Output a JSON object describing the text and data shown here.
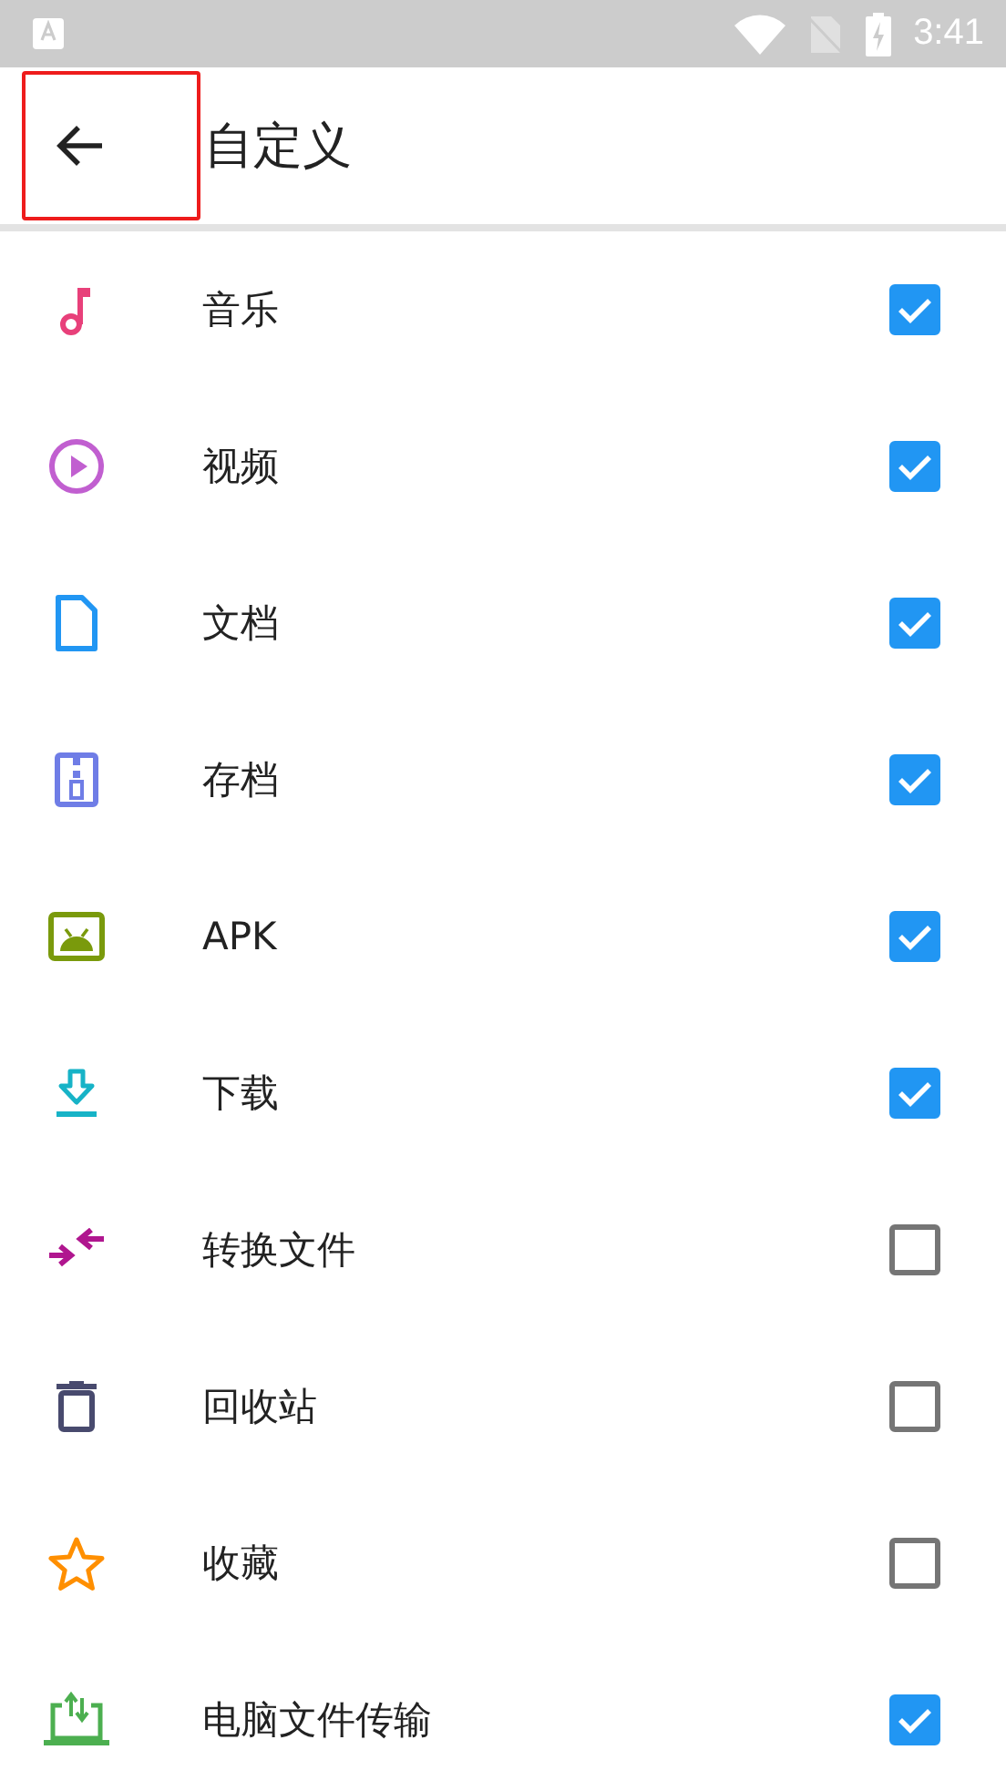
{
  "status_bar": {
    "time": "3:41"
  },
  "toolbar": {
    "title": "自定义",
    "back_highlighted": true
  },
  "items": [
    {
      "label": "音乐",
      "kind": "music",
      "color": "#e8407a",
      "checked": true
    },
    {
      "label": "视频",
      "kind": "video",
      "color": "#c15fd0",
      "checked": true
    },
    {
      "label": "文档",
      "kind": "document",
      "color": "#2196f3",
      "checked": true
    },
    {
      "label": "存档",
      "kind": "archive",
      "color": "#6f7de6",
      "checked": true
    },
    {
      "label": "APK",
      "kind": "apk",
      "color": "#7a9a0c",
      "checked": true
    },
    {
      "label": "下载",
      "kind": "download",
      "color": "#17b3c7",
      "checked": true
    },
    {
      "label": "转换文件",
      "kind": "convert",
      "color": "#b0168f",
      "checked": false
    },
    {
      "label": "回收站",
      "kind": "trash",
      "color": "#484a6e",
      "checked": false
    },
    {
      "label": "收藏",
      "kind": "star",
      "color": "#ff8f00",
      "checked": false
    },
    {
      "label": "电脑文件传输",
      "kind": "transfer",
      "color": "#4caf50",
      "checked": true
    }
  ]
}
